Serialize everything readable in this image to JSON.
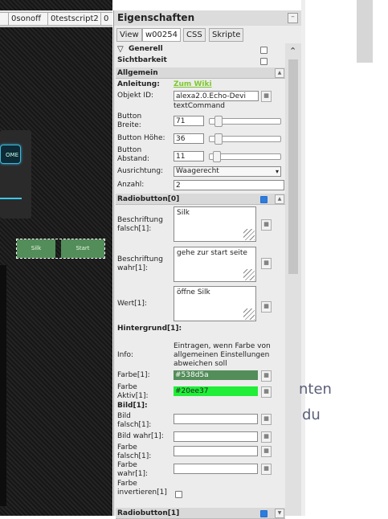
{
  "editor": {
    "view_tabs": [
      "",
      "0sonoff",
      "0testscript2",
      "0"
    ],
    "home_button_label": "OME",
    "radio_buttons": [
      "Silk",
      "Start"
    ]
  },
  "properties": {
    "title": "Eigenschaften",
    "collapse_symbol": "–",
    "tabs": [
      "View",
      "w00254",
      "CSS",
      "Skripte"
    ],
    "scroll_up": "⌃",
    "filter": {
      "label": "Generell"
    },
    "visibility": {
      "label": "Sichtbarkeit"
    },
    "allgemein": {
      "label": "Allgemein",
      "anleitung_label": "Anleitung:",
      "anleitung_link": "Zum Wiki",
      "object_id_label": "Objekt ID:",
      "object_id_value": "alexa2.0.Echo-Devi",
      "object_id_sub": "textCommand",
      "button_breite_label": "Button Breite:",
      "button_breite_value": "71",
      "button_hoehe_label": "Button Höhe:",
      "button_hoehe_value": "36",
      "button_abstand_label": "Button Abstand:",
      "button_abstand_value": "11",
      "ausrichtung_label": "Ausrichtung:",
      "ausrichtung_value": "Waagerecht",
      "anzahl_label": "Anzahl:",
      "anzahl_value": "2"
    },
    "radiobutton0": {
      "label": "Radiobutton[0]",
      "beschriftung_falsch_label": "Beschriftung falsch[1]:",
      "beschriftung_falsch_value": "Silk",
      "beschriftung_wahr_label": "Beschriftung wahr[1]:",
      "beschriftung_wahr_value": "gehe zur start seite",
      "wert_label": "Wert[1]:",
      "wert_value": "öffne Silk",
      "hintergrund_label": "Hintergrund[1]:",
      "info_label": "Info:",
      "info_value": "Eintragen, wenn Farbe von allgemeinen Einstellungen abweichen soll",
      "farbe_label": "Farbe[1]:",
      "farbe_value": "#538d5a",
      "farbe_aktiv_label": "Farbe Aktiv[1]:",
      "farbe_aktiv_value": "#20ee37",
      "bild_label": "Bild[1]:",
      "bild_falsch_label": "Bild falsch[1]:",
      "bild_wahr_label": "Bild wahr[1]:",
      "farbe_falsch_label": "Farbe falsch[1]:",
      "farbe_wahr_label": "Farbe wahr[1]:",
      "farbe_invertieren_label": "Farbe invertieren[1]"
    },
    "radiobutton1": {
      "label": "Radiobutton[1]"
    },
    "button_icon_text": "▦"
  },
  "right_page": {
    "line1": "nten",
    "line2": "du"
  },
  "colors": {
    "radio_bg": "#538d5a",
    "active": "#20ee37",
    "accent_cyan": "#37c8f0",
    "link": "#7cc82b"
  }
}
